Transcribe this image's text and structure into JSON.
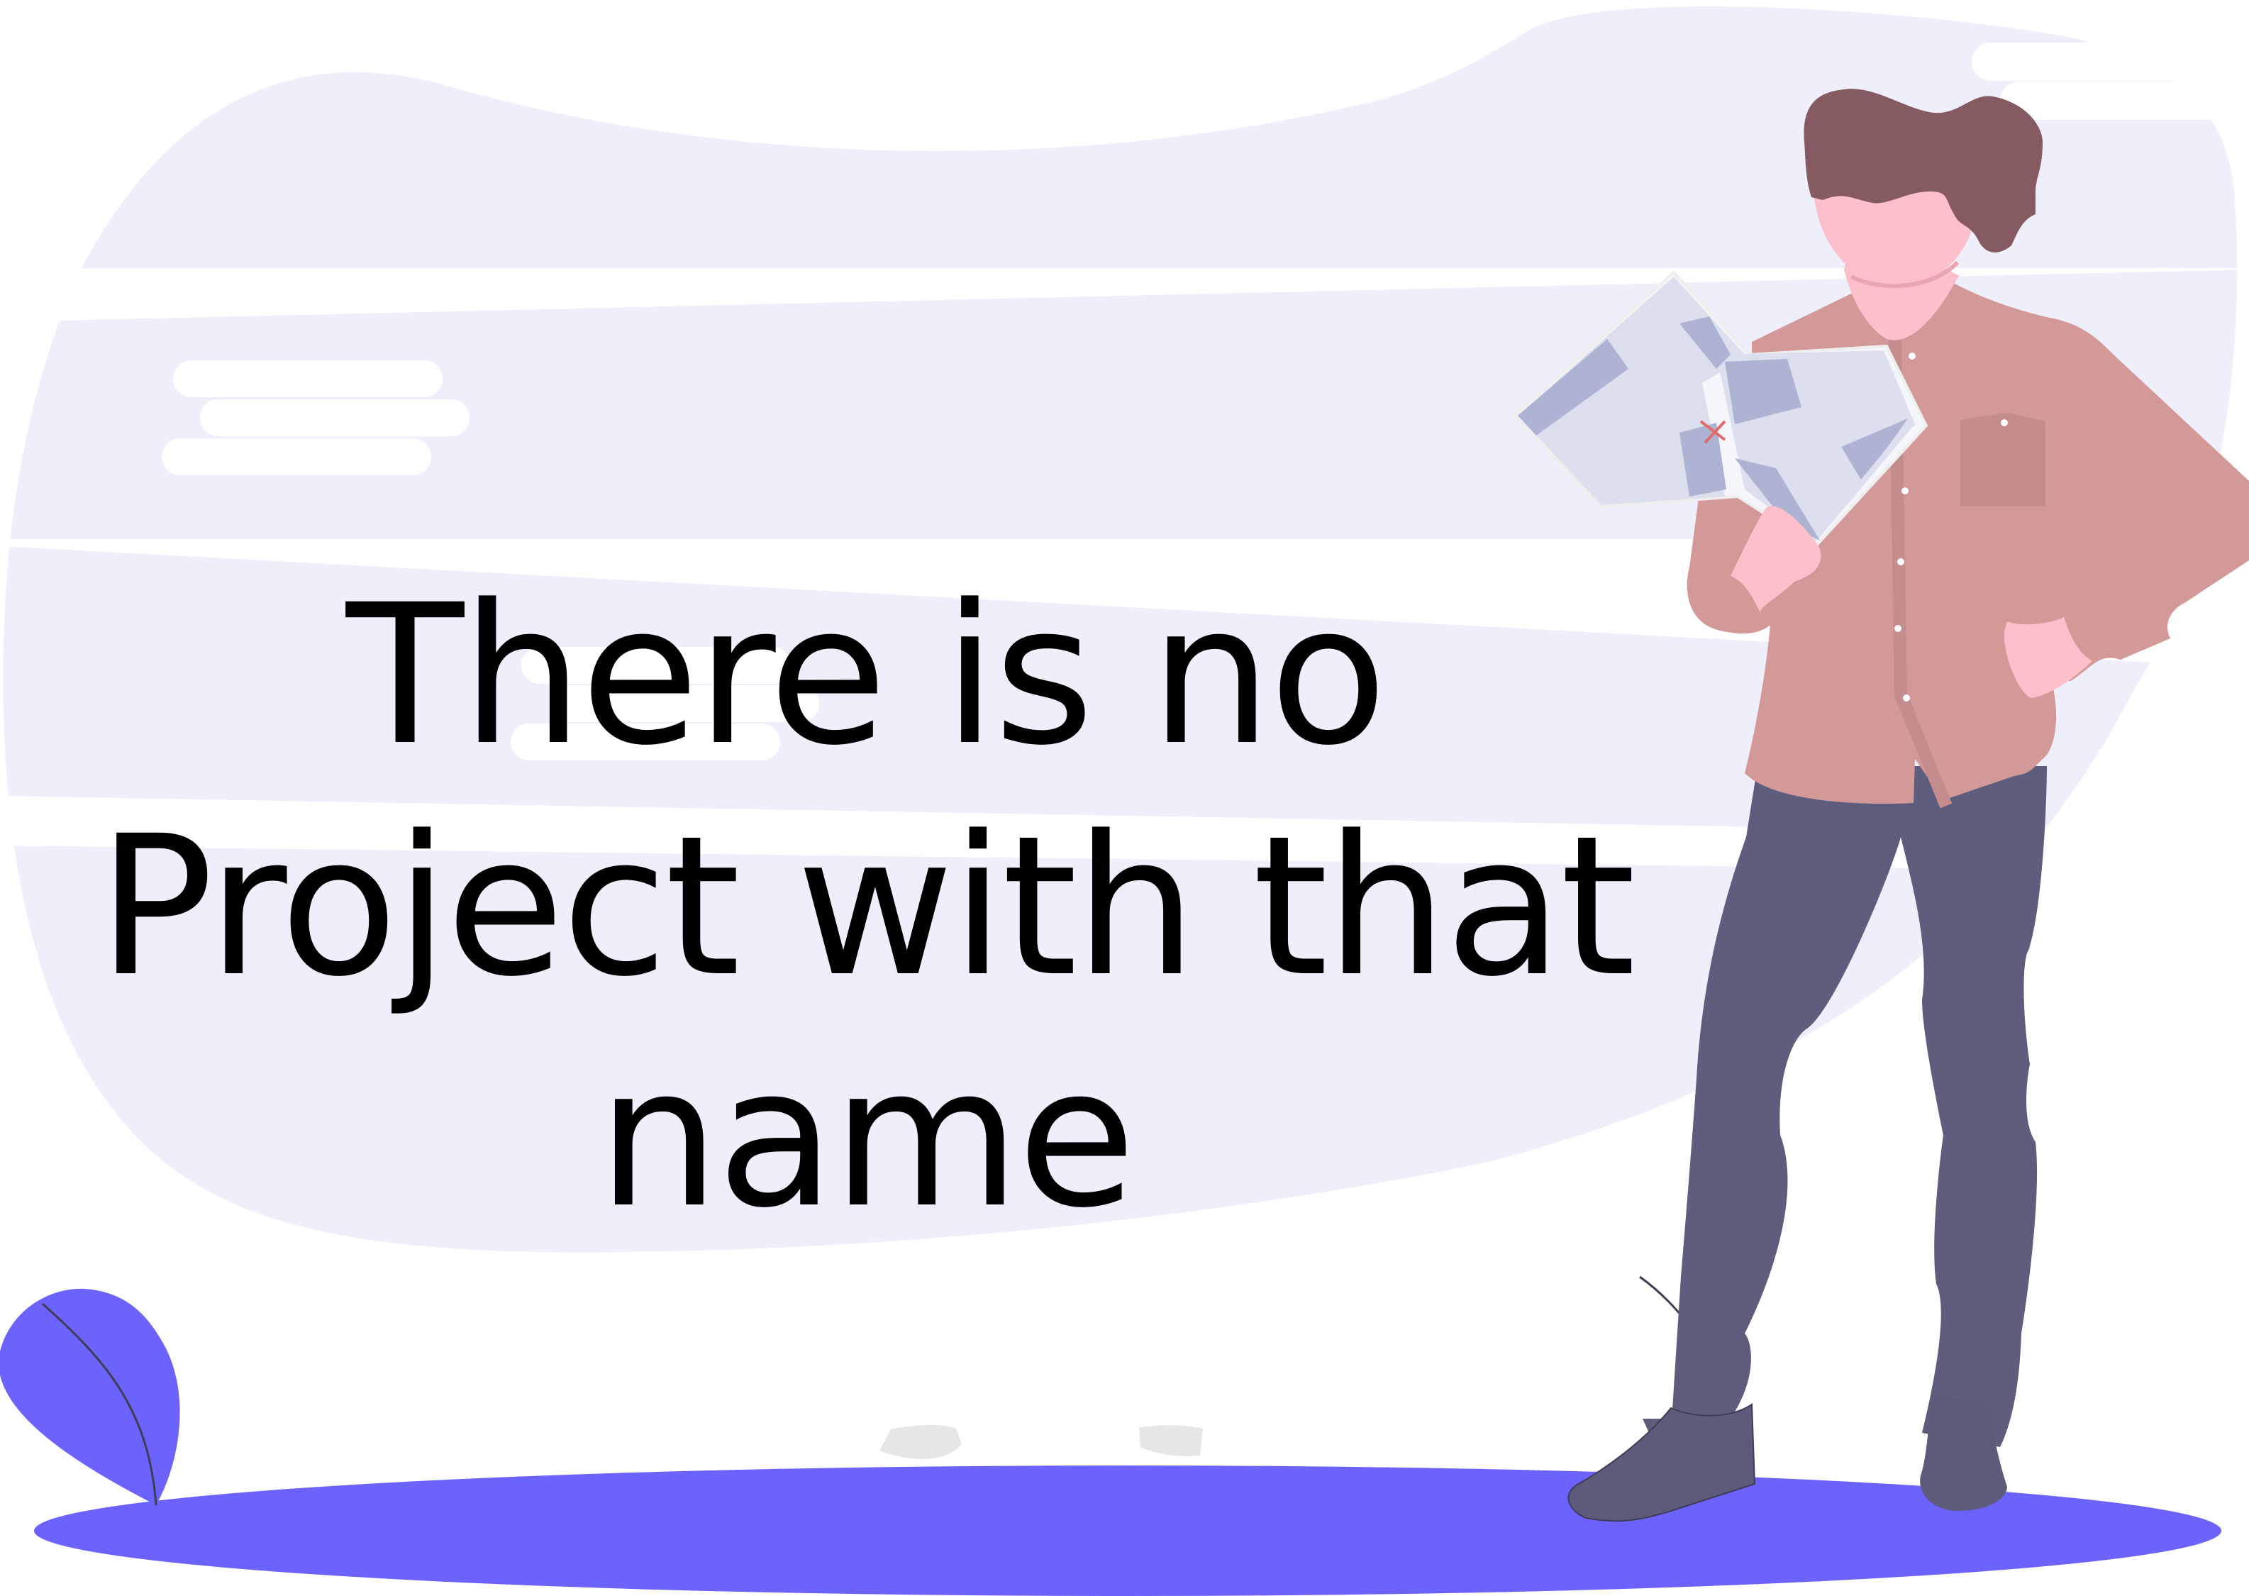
{
  "page": {
    "message": "There is no Project with that name"
  },
  "illustration": {
    "subject": "man-reading-map",
    "palette": {
      "background_blob": "#efeffb",
      "ground": "#6c63ff",
      "leaf": "#6c63ff",
      "shirt": "#d39999",
      "pants": "#5f5d7e",
      "skin": "#fdbfc9",
      "hair": "#865a61",
      "map": "#dcdfed",
      "map_accent": "#adb3d3",
      "stone": "#e6e6e6"
    }
  }
}
